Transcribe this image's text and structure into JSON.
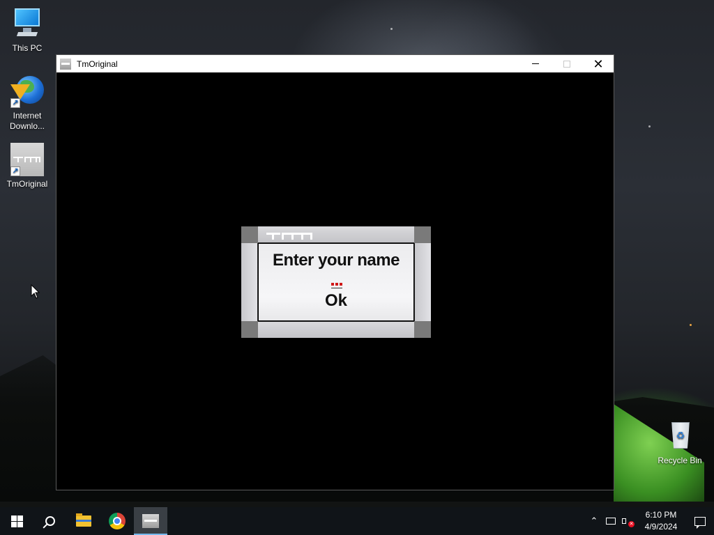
{
  "desktop": {
    "icons": [
      {
        "label": "This PC",
        "icon": "monitor-icon"
      },
      {
        "label": "Internet\nDownlo...",
        "icon": "idm-icon"
      },
      {
        "label": "TmOriginal",
        "icon": "tmoriginal-icon"
      },
      {
        "label": "Recycle Bin",
        "icon": "recycle-bin-icon"
      }
    ]
  },
  "window": {
    "title": "TmOriginal",
    "controls": {
      "minimize": "minimize",
      "maximize": "maximize",
      "close": "close"
    }
  },
  "dialog": {
    "prompt": "Enter your name",
    "input_value": "",
    "ok_label": "Ok",
    "accent_color": "#d01818"
  },
  "taskbar": {
    "apps": [
      "start",
      "search",
      "file-explorer",
      "chrome",
      "tmoriginal"
    ],
    "active_app": "tmoriginal",
    "clock": {
      "time": "6:10 PM",
      "date": "4/9/2024"
    },
    "tray": [
      "chevron-up-icon",
      "network-icon",
      "volume-muted-icon"
    ]
  }
}
